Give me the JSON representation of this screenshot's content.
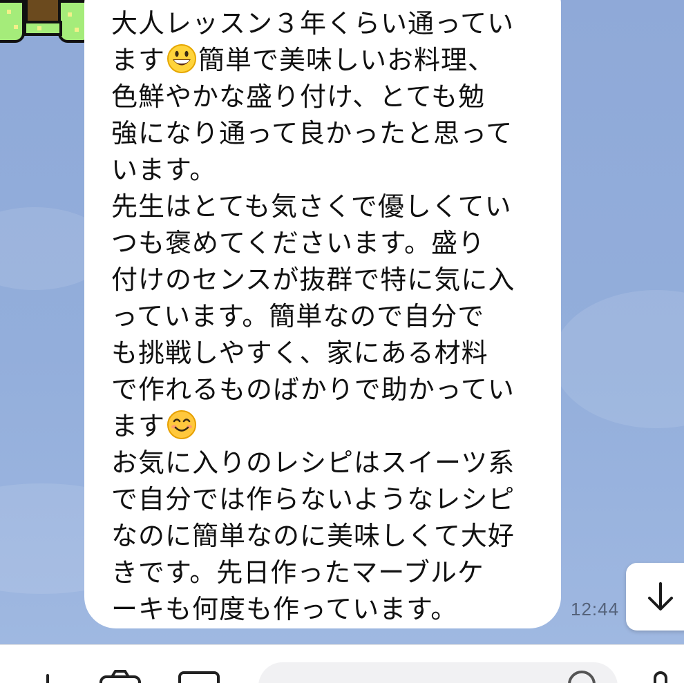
{
  "message": {
    "lines": [
      "大人レッスン３年くらい通ってい",
      "ます",
      "簡単で美味しいお料理、",
      "色鮮やかな盛り付け、とても勉",
      "強になり通って良かったと思って",
      "います。",
      "先生はとても気さくで優しくてい",
      "つも褒めてくださいます。盛り",
      "付けのセンスが抜群で特に気に入",
      "っています。簡単なので自分で",
      "も挑戦しやすく、家にある材料",
      "で作れるものばかりで助かってい",
      "ます",
      "お気に入りのレシピはスイーツ系",
      "で自分では作らないようなレシピ",
      "なのに簡単なのに美味しくて大好",
      "きです。先日作ったマーブルケ",
      "ーキも何度も作っています。"
    ],
    "emojis": [
      "grinning-face-emoji",
      "smiling-face-emoji"
    ]
  },
  "timestamp": "12:44",
  "icons": {
    "scroll_down": "arrow-down-icon",
    "avatar": "avatar-bow",
    "toolbar": [
      "plus-icon",
      "camera-icon",
      "image-icon",
      "emoji-icon",
      "mic-icon"
    ]
  },
  "colors": {
    "chat_background": "#8fa9d8",
    "bubble": "#ffffff",
    "text": "#111111",
    "timestamp": "#54627a"
  }
}
